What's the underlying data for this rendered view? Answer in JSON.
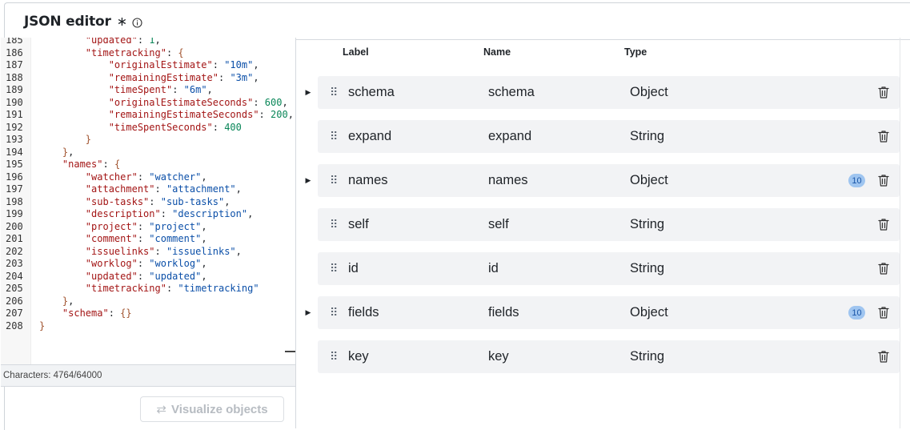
{
  "header": {
    "title": "JSON editor",
    "required_mark": "∗",
    "info_icon": "info-icon"
  },
  "editor": {
    "lines": [
      {
        "n": "185",
        "html": "        <span class=\"k\">\"updated\"</span><span class=\"p\">: </span><span class=\"n\">1</span><span class=\"p\">,</span>"
      },
      {
        "n": "186",
        "html": "        <span class=\"k\">\"timetracking\"</span><span class=\"p\">: </span><span class=\"b\">{</span>"
      },
      {
        "n": "187",
        "html": "            <span class=\"k\">\"originalEstimate\"</span><span class=\"p\">: </span><span class=\"s\">\"10m\"</span><span class=\"p\">,</span>"
      },
      {
        "n": "188",
        "html": "            <span class=\"k\">\"remainingEstimate\"</span><span class=\"p\">: </span><span class=\"s\">\"3m\"</span><span class=\"p\">,</span>"
      },
      {
        "n": "189",
        "html": "            <span class=\"k\">\"timeSpent\"</span><span class=\"p\">: </span><span class=\"s\">\"6m\"</span><span class=\"p\">,</span>"
      },
      {
        "n": "190",
        "html": "            <span class=\"k\">\"originalEstimateSeconds\"</span><span class=\"p\">: </span><span class=\"n\">600</span><span class=\"p\">,</span>"
      },
      {
        "n": "191",
        "html": "            <span class=\"k\">\"remainingEstimateSeconds\"</span><span class=\"p\">: </span><span class=\"n\">200</span><span class=\"p\">,</span>"
      },
      {
        "n": "192",
        "html": "            <span class=\"k\">\"timeSpentSeconds\"</span><span class=\"p\">: </span><span class=\"n\">400</span>"
      },
      {
        "n": "193",
        "html": "        <span class=\"b\">}</span>"
      },
      {
        "n": "194",
        "html": "    <span class=\"b\">}</span><span class=\"p\">,</span>"
      },
      {
        "n": "195",
        "html": "    <span class=\"k\">\"names\"</span><span class=\"p\">: </span><span class=\"b\">{</span>"
      },
      {
        "n": "196",
        "html": "        <span class=\"k\">\"watcher\"</span><span class=\"p\">: </span><span class=\"s\">\"watcher\"</span><span class=\"p\">,</span>"
      },
      {
        "n": "197",
        "html": "        <span class=\"k\">\"attachment\"</span><span class=\"p\">: </span><span class=\"s\">\"attachment\"</span><span class=\"p\">,</span>"
      },
      {
        "n": "198",
        "html": "        <span class=\"k\">\"sub-tasks\"</span><span class=\"p\">: </span><span class=\"s\">\"sub-tasks\"</span><span class=\"p\">,</span>"
      },
      {
        "n": "199",
        "html": "        <span class=\"k\">\"description\"</span><span class=\"p\">: </span><span class=\"s\">\"description\"</span><span class=\"p\">,</span>"
      },
      {
        "n": "200",
        "html": "        <span class=\"k\">\"project\"</span><span class=\"p\">: </span><span class=\"s\">\"project\"</span><span class=\"p\">,</span>"
      },
      {
        "n": "201",
        "html": "        <span class=\"k\">\"comment\"</span><span class=\"p\">: </span><span class=\"s\">\"comment\"</span><span class=\"p\">,</span>"
      },
      {
        "n": "202",
        "html": "        <span class=\"k\">\"issuelinks\"</span><span class=\"p\">: </span><span class=\"s\">\"issuelinks\"</span><span class=\"p\">,</span>"
      },
      {
        "n": "203",
        "html": "        <span class=\"k\">\"worklog\"</span><span class=\"p\">: </span><span class=\"s\">\"worklog\"</span><span class=\"p\">,</span>"
      },
      {
        "n": "204",
        "html": "        <span class=\"k\">\"updated\"</span><span class=\"p\">: </span><span class=\"s\">\"updated\"</span><span class=\"p\">,</span>"
      },
      {
        "n": "205",
        "html": "        <span class=\"k\">\"timetracking\"</span><span class=\"p\">: </span><span class=\"s\">\"timetracking\"</span>"
      },
      {
        "n": "206",
        "html": "    <span class=\"b\">}</span><span class=\"p\">,</span>"
      },
      {
        "n": "207",
        "html": "    <span class=\"k\">\"schema\"</span><span class=\"p\">: </span><span class=\"b\">{}</span>"
      },
      {
        "n": "208",
        "html": "<span class=\"b\">}</span>"
      }
    ],
    "characters": "Characters: 4764/64000"
  },
  "visualize_button": {
    "icon": "swap-icon",
    "label": "Visualize objects"
  },
  "table": {
    "columns": {
      "label": "Label",
      "name": "Name",
      "type": "Type"
    },
    "rows": [
      {
        "label": "schema",
        "name": "schema",
        "type": "Object",
        "expandable": true,
        "badge": ""
      },
      {
        "label": "expand",
        "name": "expand",
        "type": "String",
        "expandable": false,
        "badge": ""
      },
      {
        "label": "names",
        "name": "names",
        "type": "Object",
        "expandable": true,
        "badge": "10"
      },
      {
        "label": "self",
        "name": "self",
        "type": "String",
        "expandable": false,
        "badge": ""
      },
      {
        "label": "id",
        "name": "id",
        "type": "String",
        "expandable": false,
        "badge": ""
      },
      {
        "label": "fields",
        "name": "fields",
        "type": "Object",
        "expandable": true,
        "badge": "10"
      },
      {
        "label": "key",
        "name": "key",
        "type": "String",
        "expandable": false,
        "badge": ""
      }
    ]
  },
  "colors": {
    "key": "#a31515",
    "string": "#0b4fa8",
    "number": "#098658",
    "row_bg": "#f2f3f5",
    "badge_bg": "#9fc5f0"
  }
}
